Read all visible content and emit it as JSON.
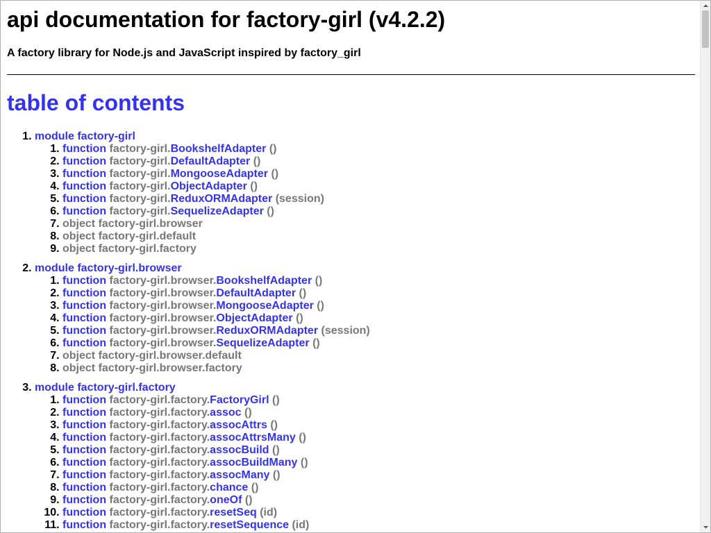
{
  "page": {
    "title": "api documentation for factory-girl (v4.2.2)",
    "subtitle": "A factory library for Node.js and JavaScript inspired by factory_girl",
    "toc_heading": "table of contents"
  },
  "colors": {
    "link": "#3333ee",
    "muted": "#777777",
    "text": "#000000"
  },
  "modules": [
    {
      "label": "module factory-girl",
      "members": [
        {
          "kind": "function",
          "prefix": "factory-girl.",
          "name": "BookshelfAdapter",
          "args": "()"
        },
        {
          "kind": "function",
          "prefix": "factory-girl.",
          "name": "DefaultAdapter",
          "args": "()"
        },
        {
          "kind": "function",
          "prefix": "factory-girl.",
          "name": "MongooseAdapter",
          "args": "()"
        },
        {
          "kind": "function",
          "prefix": "factory-girl.",
          "name": "ObjectAdapter",
          "args": "()"
        },
        {
          "kind": "function",
          "prefix": "factory-girl.",
          "name": "ReduxORMAdapter",
          "args": "(session)"
        },
        {
          "kind": "function",
          "prefix": "factory-girl.",
          "name": "SequelizeAdapter",
          "args": "()"
        },
        {
          "kind": "object",
          "text": "object factory-girl.browser"
        },
        {
          "kind": "object",
          "text": "object factory-girl.default"
        },
        {
          "kind": "object",
          "text": "object factory-girl.factory"
        }
      ]
    },
    {
      "label": "module factory-girl.browser",
      "members": [
        {
          "kind": "function",
          "prefix": "factory-girl.browser.",
          "name": "BookshelfAdapter",
          "args": "()"
        },
        {
          "kind": "function",
          "prefix": "factory-girl.browser.",
          "name": "DefaultAdapter",
          "args": "()"
        },
        {
          "kind": "function",
          "prefix": "factory-girl.browser.",
          "name": "MongooseAdapter",
          "args": "()"
        },
        {
          "kind": "function",
          "prefix": "factory-girl.browser.",
          "name": "ObjectAdapter",
          "args": "()"
        },
        {
          "kind": "function",
          "prefix": "factory-girl.browser.",
          "name": "ReduxORMAdapter",
          "args": "(session)"
        },
        {
          "kind": "function",
          "prefix": "factory-girl.browser.",
          "name": "SequelizeAdapter",
          "args": "()"
        },
        {
          "kind": "object",
          "text": "object factory-girl.browser.default"
        },
        {
          "kind": "object",
          "text": "object factory-girl.browser.factory"
        }
      ]
    },
    {
      "label": "module factory-girl.factory",
      "members": [
        {
          "kind": "function",
          "prefix": "factory-girl.factory.",
          "name": "FactoryGirl",
          "args": "()"
        },
        {
          "kind": "function",
          "prefix": "factory-girl.factory.",
          "name": "assoc",
          "args": "()"
        },
        {
          "kind": "function",
          "prefix": "factory-girl.factory.",
          "name": "assocAttrs",
          "args": "()"
        },
        {
          "kind": "function",
          "prefix": "factory-girl.factory.",
          "name": "assocAttrsMany",
          "args": "()"
        },
        {
          "kind": "function",
          "prefix": "factory-girl.factory.",
          "name": "assocBuild",
          "args": "()"
        },
        {
          "kind": "function",
          "prefix": "factory-girl.factory.",
          "name": "assocBuildMany",
          "args": "()"
        },
        {
          "kind": "function",
          "prefix": "factory-girl.factory.",
          "name": "assocMany",
          "args": "()"
        },
        {
          "kind": "function",
          "prefix": "factory-girl.factory.",
          "name": "chance",
          "args": "()"
        },
        {
          "kind": "function",
          "prefix": "factory-girl.factory.",
          "name": "oneOf",
          "args": "()"
        },
        {
          "kind": "function",
          "prefix": "factory-girl.factory.",
          "name": "resetSeq",
          "args": "(id)"
        },
        {
          "kind": "function",
          "prefix": "factory-girl.factory.",
          "name": "resetSequence",
          "args": "(id)"
        }
      ]
    }
  ]
}
